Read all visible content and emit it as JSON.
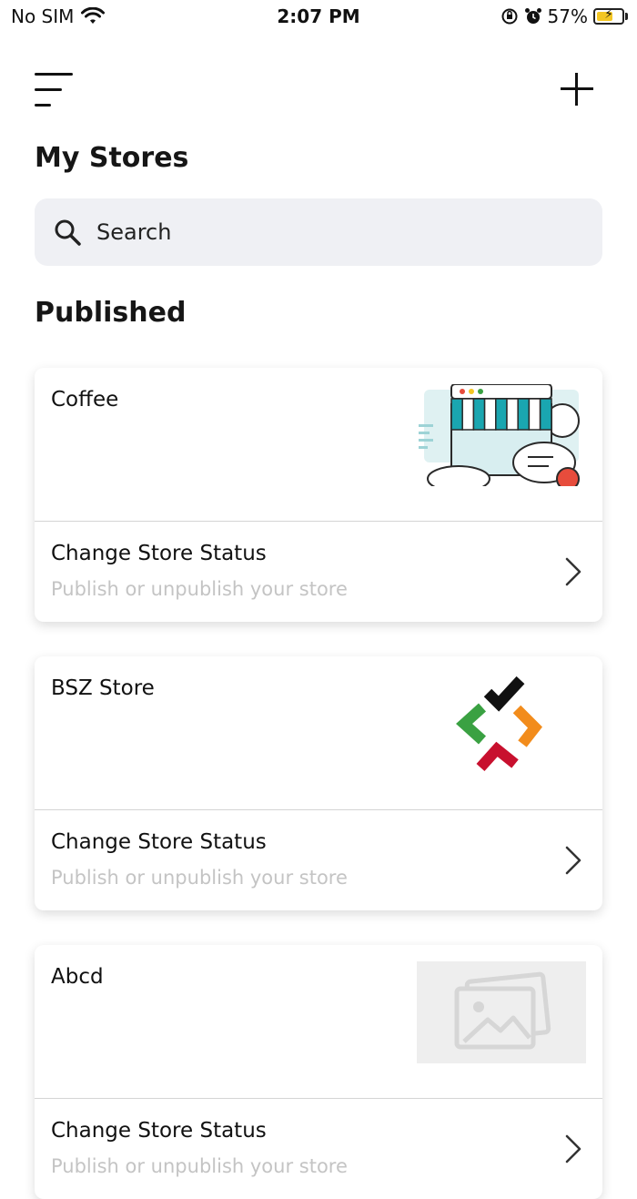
{
  "status_bar": {
    "carrier": "No SIM",
    "time": "2:07 PM",
    "battery": "57%"
  },
  "header": {
    "menu_icon": "menu-icon",
    "add_icon": "plus-icon"
  },
  "page_title": "My Stores",
  "search": {
    "placeholder": "Search"
  },
  "section_title": "Published",
  "stores": [
    {
      "name": "Coffee",
      "status_title": "Change Store Status",
      "status_subtitle": "Publish or unpublish your store",
      "thumbnail": "storefront-illustration"
    },
    {
      "name": "BSZ Store",
      "status_title": "Change Store Status",
      "status_subtitle": "Publish or unpublish your store",
      "thumbnail": "arrows-logo"
    },
    {
      "name": "Abcd",
      "status_title": "Change Store Status",
      "status_subtitle": "Publish or unpublish your store",
      "thumbnail": "image-placeholder"
    }
  ],
  "colors": {
    "search_bg": "#eff0f4",
    "subtitle": "#c4c4c4",
    "awning_teal": "#1aa6b0",
    "logo_green": "#3aa142",
    "logo_orange": "#f28c1c",
    "logo_red": "#c8102e",
    "logo_black": "#111111"
  }
}
